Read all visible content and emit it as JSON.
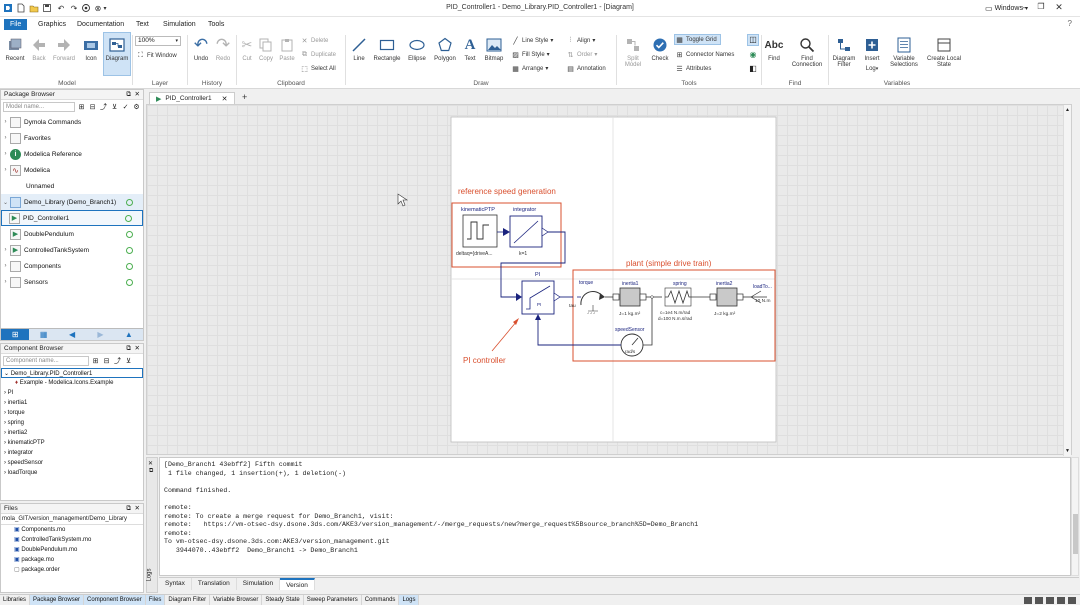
{
  "window": {
    "title": "PID_Controller1 - Demo_Library.PID_Controller1 - [Diagram]",
    "layout_selector": "Windows"
  },
  "menu": [
    "File",
    "Graphics",
    "Documentation",
    "Text",
    "Simulation",
    "Tools"
  ],
  "ribbon": {
    "model": {
      "recent": "Recent",
      "back": "Back",
      "forward": "Forward",
      "icon": "Icon",
      "diagram": "Diagram",
      "group": "Model"
    },
    "layer": {
      "zoom": "100%",
      "fit": "Fit Window",
      "group": "Layer"
    },
    "history": {
      "undo": "Undo",
      "redo": "Redo",
      "group": "History"
    },
    "clipboard": {
      "cut": "Cut",
      "copy": "Copy",
      "paste": "Paste",
      "delete": "Delete",
      "duplicate": "Duplicate",
      "select_all": "Select All",
      "group": "Clipboard"
    },
    "draw": {
      "line": "Line",
      "rectangle": "Rectangle",
      "ellipse": "Ellipse",
      "polygon": "Polygon",
      "text": "Text",
      "bitmap": "Bitmap",
      "line_style": "Line Style",
      "fill_style": "Fill Style",
      "arrange": "Arrange",
      "align": "Align",
      "order": "Order",
      "annotation": "Annotation",
      "group": "Draw"
    },
    "tools": {
      "split": "Split",
      "split2": "Model",
      "check": "Check",
      "toggle_grid": "Toggle Grid",
      "connector_names": "Connector Names",
      "attributes": "Attributes",
      "group": "Tools"
    },
    "find": {
      "find": "Find",
      "find_conn": "Find",
      "find_conn2": "Connection",
      "group": "Find"
    },
    "variables": {
      "diagram_filter": "Diagram",
      "diagram_filter2": "Filter",
      "insert": "Insert",
      "log": "Log",
      "varsel": "Variable",
      "varsel2": "Selections",
      "createlocal": "Create Local",
      "createlocal2": "State",
      "group": "Variables"
    }
  },
  "package_browser": {
    "title": "Package Browser",
    "search_placeholder": "Model name...",
    "items": [
      {
        "label": "Dymola Commands",
        "expander": "›"
      },
      {
        "label": "Favorites",
        "expander": "›"
      },
      {
        "label": "Modelica Reference",
        "expander": "›"
      },
      {
        "label": "Modelica",
        "expander": "›"
      },
      {
        "label": "Unnamed",
        "expander": ""
      },
      {
        "label": "Demo_Library (Demo_Branch1)",
        "expander": "⌄"
      },
      {
        "label": "PID_Controller1",
        "expander": ""
      },
      {
        "label": "DoublePendulum",
        "expander": ""
      },
      {
        "label": "ControlledTankSystem",
        "expander": "›"
      },
      {
        "label": "Components",
        "expander": "›"
      },
      {
        "label": "Sensors",
        "expander": "›"
      }
    ]
  },
  "component_browser": {
    "title": "Component Browser",
    "search_placeholder": "Component name...",
    "root": "Demo_Library.PID_Controller1",
    "example": "Example - Modelica.Icons.Example",
    "items": [
      "PI",
      "inertia1",
      "torque",
      "spring",
      "inertia2",
      "kinematicPTP",
      "integrator",
      "speedSensor",
      "loadTorque"
    ]
  },
  "files": {
    "title": "Files",
    "path": "mola_GIT/version_management/Demo_Library",
    "items": [
      "Components.mo",
      "ControlledTankSystem.mo",
      "DoublePendulum.mo",
      "package.mo",
      "package.order"
    ]
  },
  "doc_tab": {
    "label": "PID_Controller1",
    "add": "+"
  },
  "diagram": {
    "ref_label": "reference speed generation",
    "plant_label": "plant (simple drive train)",
    "pi_label": "PI controller",
    "kinematic": "kinematicPTP",
    "kinematic_param": "deltaq={driveA...",
    "integrator": "integrator",
    "integrator_param": "k=1",
    "pi": "PI",
    "torque": "torque",
    "tau": "tau",
    "inertia1": "inertia1",
    "inertia1_param": "J=1 kg.m²",
    "spring": "spring",
    "spring_param1": "c=1e4 N.m/rad",
    "spring_param2": "d=100 N.m.s/rad",
    "inertia2": "inertia2",
    "inertia2_param": "J=2 kg.m²",
    "loadtorque": "loadTo...",
    "loadtorque_param": "10 N.m",
    "speedsensor": "speedSensor",
    "speedsensor_unit": "rad/s"
  },
  "console": {
    "lines": [
      "[Demo_Branch1 43ebff2] Fifth commit",
      " 1 file changed, 1 insertion(+), 1 deletion(-)",
      "",
      "Command finished.",
      "",
      "remote:",
      "remote: To create a merge request for Demo_Branch1, visit:",
      "remote:   https://vm-otsec-dsy.dsone.3ds.com/AKE3/version_management/-/merge_requests/new?merge_request%5Bsource_branch%5D=Demo_Branch1",
      "remote:",
      "To vm-otsec-dsy.dsone.3ds.com:AKE3/version_management.git",
      "   3944070..43ebff2  Demo_Branch1 -> Demo_Branch1"
    ],
    "side_label": "Logs",
    "tabs": [
      "Syntax",
      "Translation",
      "Simulation",
      "Version"
    ]
  },
  "statusbar": [
    "Libraries",
    "Package Browser",
    "Component Browser",
    "Files",
    "Diagram Filter",
    "Variable Browser",
    "Steady State",
    "Sweep Parameters",
    "Commands",
    "Logs"
  ],
  "colors": {
    "accent": "#1e73be",
    "annotation": "#d9502f",
    "diagram_line": "#1a237e"
  }
}
